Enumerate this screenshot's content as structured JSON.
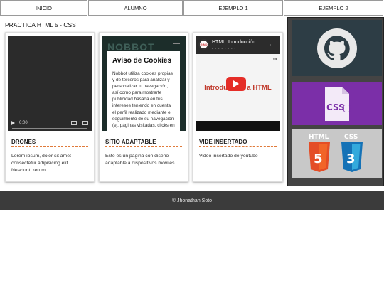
{
  "nav": {
    "items": [
      {
        "label": "INICIO"
      },
      {
        "label": "ALUMNO"
      },
      {
        "label": "EJEMPLO 1"
      },
      {
        "label": "EJEMPLO 2"
      }
    ]
  },
  "page": {
    "title": "PRACTICA HTML 5 - CSS"
  },
  "cards": [
    {
      "title": "DRONES",
      "text": "Lorem ipsum, dolor sit amet consectetur adipisicing elit. Nesciunt, rerum.",
      "video_time": "0:00"
    },
    {
      "title": "SITIO ADAPTABLE",
      "text": "Este es un pagina con diseño adaptable a dispositivos moviles",
      "cookie": {
        "logo": "NOBBOT",
        "heading": "Aviso de Cookies",
        "body": "Nobbot utiliza cookies propias y de terceros para analizar y personalizar tu navegación, así como para mostrarte publicidad basada en tus intereses teniendo en cuenta el perfil realizado mediante el seguimiento de su navegación (ej. páginas visitadas, clicks en"
      }
    },
    {
      "title": "VIDE INSERTADO",
      "text": "Video insertado de youtube",
      "youtube": {
        "title": "HTML. Introducción",
        "big_text": "Introducción a HTML"
      }
    }
  ],
  "side_panel": {
    "tiles": [
      {
        "icon": "github-icon"
      },
      {
        "icon": "css-icon",
        "label": "CSS"
      },
      {
        "icon": "html5-css3-icon",
        "labels": [
          "HTML",
          "CSS"
        ]
      }
    ]
  },
  "footer": {
    "text": "© Jhonathan Soto"
  }
}
